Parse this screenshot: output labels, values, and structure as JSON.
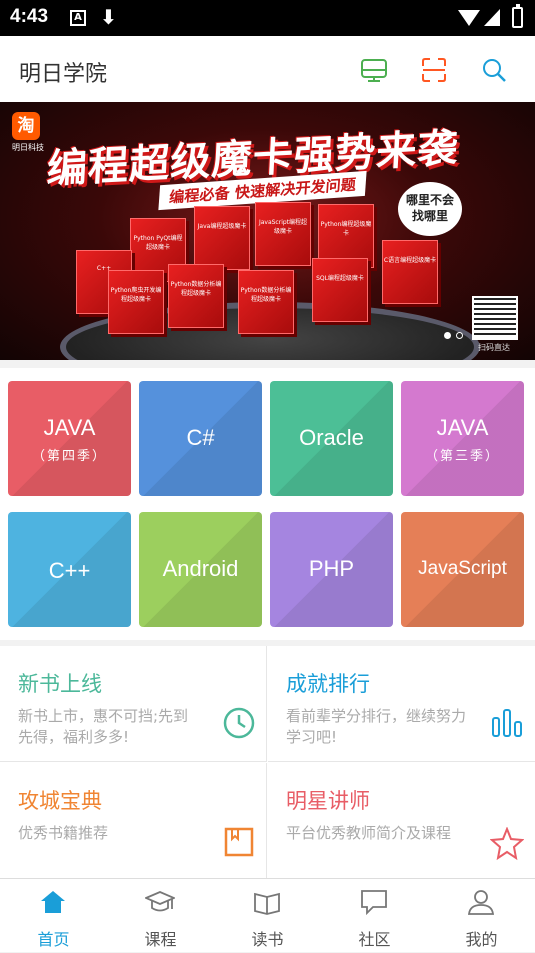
{
  "status_bar": {
    "time": "4:43",
    "notification_a": "A",
    "download_glyph": "⬇"
  },
  "app_bar": {
    "title": "明日学院",
    "icons": [
      "tv-icon",
      "scan-icon",
      "search-icon"
    ],
    "icon_colors": {
      "tv": "#4caf50",
      "scan": "#ff5722",
      "search": "#1a9ed8"
    }
  },
  "banner": {
    "logo_glyph": "淘",
    "logo_text": "明日科技",
    "headline": "编程超级魔卡强势来袭",
    "subline": "编程必备 快速解决开发问题",
    "bubble_line1": "哪里不会",
    "bubble_line2": "找哪里",
    "qr_caption": "扫码直达",
    "books": [
      "Python PyQt编程超级魔卡",
      "Java编程超级魔卡",
      "JavaScript编程超级魔卡",
      "Python编程超级魔卡",
      "C++",
      "Python爬虫开发编程超级魔卡",
      "Python数据分析编程超级魔卡",
      "Python数据分析编程超级魔卡",
      "SQL编程超级魔卡",
      "C语言编程超级魔卡"
    ],
    "page_count": 2,
    "active_page": 1
  },
  "courses": [
    {
      "name": "JAVA",
      "sub": "（第四季）",
      "color": "#e85d66"
    },
    {
      "name": "C#",
      "sub": "",
      "color": "#5591dc"
    },
    {
      "name": "Oracle",
      "sub": "",
      "color": "#4cbf96"
    },
    {
      "name": "JAVA",
      "sub": "（第三季）",
      "color": "#d479cf"
    },
    {
      "name": "C++",
      "sub": "",
      "color": "#4eb3e0"
    },
    {
      "name": "Android",
      "sub": "",
      "color": "#9ccf5e"
    },
    {
      "name": "PHP",
      "sub": "",
      "color": "#a585e0"
    },
    {
      "name": "JavaScript",
      "sub": "",
      "color": "#e57f57"
    }
  ],
  "features": [
    {
      "title": "新书上线",
      "desc": "新书上市，惠不可挡;先到先得，福利多多!",
      "icon": "clock-icon",
      "color": "#4cb89a"
    },
    {
      "title": "成就排行",
      "desc": "看前辈学分排行，继续努力学习吧!",
      "icon": "bar-chart-icon",
      "color": "#1a9ed8"
    },
    {
      "title": "攻城宝典",
      "desc": "优秀书籍推荐",
      "icon": "book-icon",
      "color": "#f08533"
    },
    {
      "title": "明星讲师",
      "desc": "平台优秀教师简介及课程",
      "icon": "star-icon",
      "color": "#e85d66"
    }
  ],
  "tabs": [
    {
      "label": "首页",
      "icon": "home-icon",
      "active": true
    },
    {
      "label": "课程",
      "icon": "graduation-cap-icon",
      "active": false
    },
    {
      "label": "读书",
      "icon": "open-book-icon",
      "active": false
    },
    {
      "label": "社区",
      "icon": "chat-bubble-icon",
      "active": false
    },
    {
      "label": "我的",
      "icon": "user-icon",
      "active": false
    }
  ],
  "colors": {
    "accent": "#1a9ed8",
    "tab_inactive": "#555555",
    "desc_text": "#aaaaaa"
  }
}
